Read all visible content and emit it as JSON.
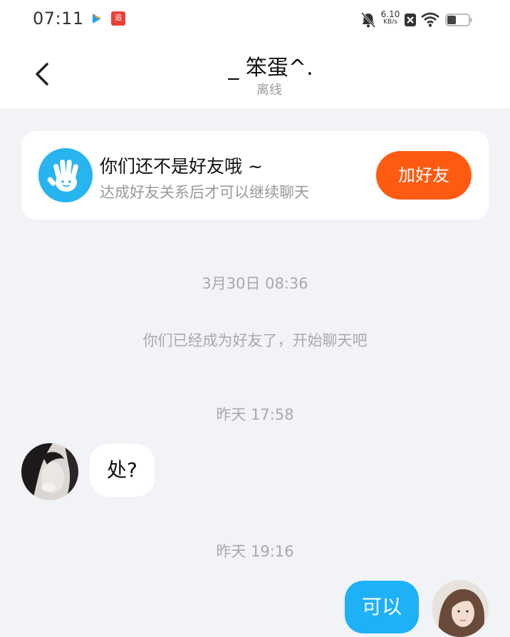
{
  "status_bar": {
    "time": "07:11",
    "net_speed_value": "6.10",
    "net_speed_unit": "KB/s",
    "app_icon_2_text": "追"
  },
  "header": {
    "name": "_ 笨蛋^.",
    "status": "离线"
  },
  "friend_card": {
    "title": "你们还不是好友哦 ~",
    "subtitle": "达成好友关系后才可以继续聊天",
    "button": "加好友"
  },
  "chat": {
    "timestamp_1": "3月30日 08:36",
    "system_note": "你们已经成为好友了，开始聊天吧",
    "timestamp_2": "昨天 17:58",
    "incoming_message": "处?",
    "timestamp_3": "昨天 19:16",
    "outgoing_message": "可以"
  },
  "colors": {
    "accent_orange": "#ff5a12",
    "bubble_blue": "#1fb1f6",
    "background": "#f2f3f7"
  },
  "icons": [
    "play-icon",
    "app-badge-icon",
    "mute-bell-icon",
    "close-box-icon",
    "wifi-icon",
    "battery-icon",
    "back-chevron-icon",
    "waving-hand-icon"
  ]
}
